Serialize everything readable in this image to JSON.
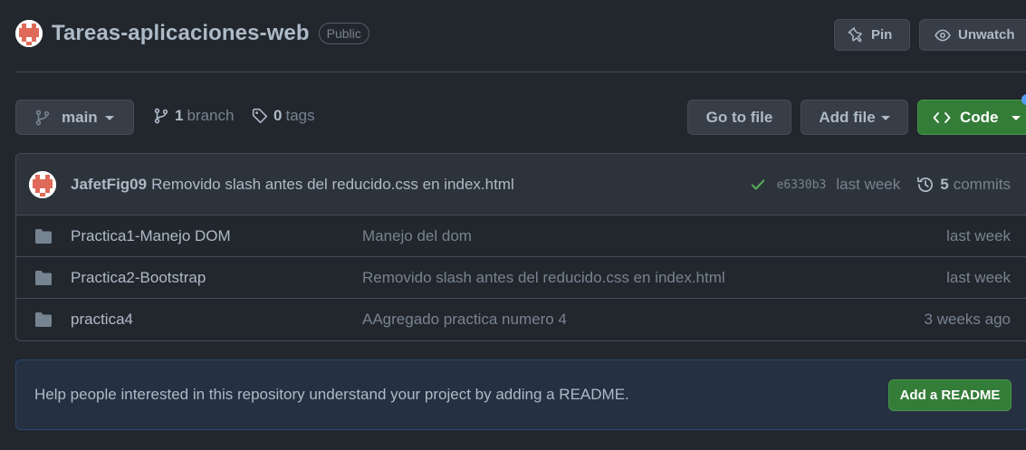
{
  "repo": {
    "name": "Tareas-aplicaciones-web",
    "visibility": "Public",
    "pin_label": "Pin",
    "watch_label": "Unwatch"
  },
  "toolbar": {
    "branch": "main",
    "branch_count": "1",
    "branch_word": "branch",
    "tag_count": "0",
    "tag_word": "tags",
    "goto_label": "Go to file",
    "addfile_label": "Add file",
    "code_label": "Code"
  },
  "commit": {
    "author": "JafetFig09",
    "message": "Removido slash antes del reducido.css en index.html",
    "sha": "e6330b3",
    "time": "last week",
    "commit_count": "5",
    "commit_word": "commits"
  },
  "files": [
    {
      "name": "Practica1-Manejo DOM",
      "message": "Manejo del dom",
      "time": "last week"
    },
    {
      "name": "Practica2-Bootstrap",
      "message": "Removido slash antes del reducido.css en index.html",
      "time": "last week"
    },
    {
      "name": "practica4",
      "message": "AAgregado practica numero 4",
      "time": "3 weeks ago"
    }
  ],
  "readme": {
    "text": "Help people interested in this repository understand your project by adding a README.",
    "button": "Add a README"
  },
  "colors": {
    "background": "#22272e",
    "primary_green": "#347d39",
    "check_green": "#57ab5a",
    "folder_icon": "#768390",
    "accent_blue": "#539bf5"
  },
  "icons": [
    "identicon-avatar",
    "pin-icon",
    "eye-icon",
    "git-branch-icon",
    "tag-icon",
    "code-icon",
    "check-icon",
    "history-icon",
    "folder-icon"
  ]
}
